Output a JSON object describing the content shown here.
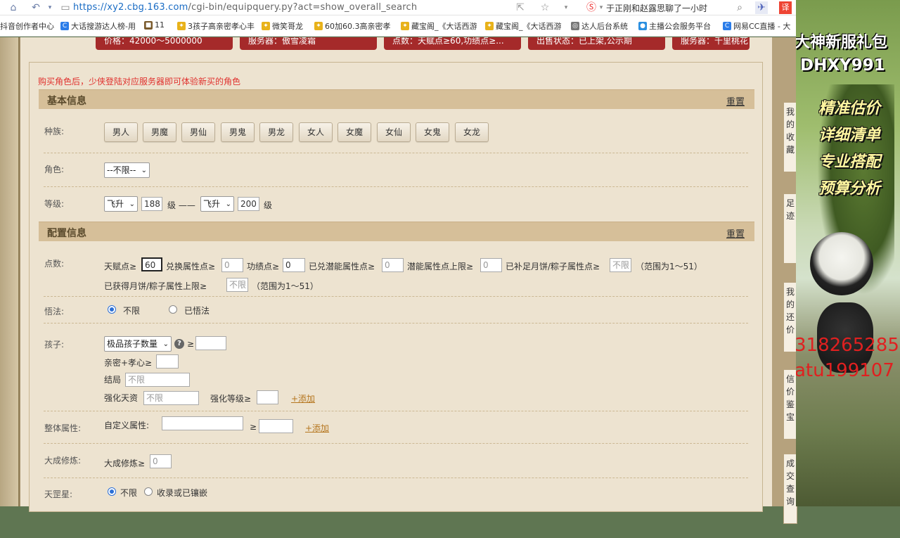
{
  "browser": {
    "url_host": "https://xy2.cbg.163.com",
    "url_path": "/cgi-bin/equipquery.py?act=show_overall_search",
    "tab_title": "于正刚和赵露思聊了一小时",
    "bookmarks": [
      "抖音创作者中心",
      "大话搜游达人榜-用",
      "11",
      "3孩子高亲密孝心丰",
      "微笑哥龙",
      "60加60.3高亲密孝",
      "藏宝阁_《大话西游",
      "藏宝阁_《大话西游",
      "达人后台系统",
      "主播公会服务平台",
      "网易CC直播 - 大"
    ]
  },
  "chips": [
    "价格：42000～5000000",
    "服务器：傲雪凌霜",
    "点数：天赋点≥60,功绩点≥...",
    "出售状态：已上架,公示期",
    "服务器：千里桃花"
  ],
  "notice": "购买角色后，少侠登陆对应服务器即可体验新买的角色",
  "basic": {
    "title": "基本信息",
    "reset": "重置",
    "race_label": "种族:",
    "races": [
      "男人",
      "男魔",
      "男仙",
      "男鬼",
      "男龙",
      "女人",
      "女魔",
      "女仙",
      "女鬼",
      "女龙"
    ],
    "role_label": "角色:",
    "role_value": "--不限--",
    "level_label": "等级:",
    "level_from_type": "飞升",
    "level_from": "188",
    "level_mid": "级 ——",
    "level_to_type": "飞升",
    "level_to": "200",
    "level_end": "级"
  },
  "config": {
    "title": "配置信息",
    "reset": "重置",
    "points_label": "点数:",
    "talent_label": "天赋点≥",
    "talent_value": "60",
    "exchange_label": "兑换属性点≥",
    "exchange_value": "0",
    "merit_label": "功绩点≥",
    "merit_value": "0",
    "potential_label": "已兑潜能属性点≥",
    "potential_value": "0",
    "potential_cap_label": "潜能属性点上限≥",
    "potential_cap_value": "0",
    "mooncake_label": "已补足月饼/粽子属性点≥",
    "mooncake_value": "不限",
    "range_note": "（范围为1～51）",
    "mooncake_cap_label": "已获得月饼/粽子属性上限≥",
    "mooncake_cap_value": "不限",
    "wu_label": "悟法:",
    "wu_opt1": "不限",
    "wu_opt2": "已悟法",
    "child_label": "孩子:",
    "child_select": "极品孩子数量",
    "ge": "≥",
    "intimacy_label": "亲密+孝心≥",
    "ending_label": "结局",
    "ending_placeholder": "不限",
    "enhance_label": "强化天资",
    "enhance_placeholder": "不限",
    "enhance_level_label": "强化等级≥",
    "add_link": "+添加",
    "attr_label": "整体属性:",
    "custom_attr_label": "自定义属性:",
    "cultivate_label": "大成修炼:",
    "cultivate_field_label": "大成修炼≥",
    "cultivate_value": "0",
    "star_label": "天罡星:",
    "star_opt1": "不限",
    "star_opt2": "收录或已镶嵌"
  },
  "side_strip": [
    "我的收藏",
    "足迹",
    "我的还价",
    "信价鉴宝",
    "成交查询"
  ],
  "ad": {
    "line1": "大神新服礼包",
    "line2": "DHXY991",
    "line3": "精准估价",
    "line4": "详细清单",
    "line5": "专业搭配",
    "line6": "预算分析",
    "line7": "318265285",
    "line8": "atu199107"
  },
  "colors": {
    "accent_red": "#a52a2a",
    "link_orange": "#b5761e",
    "notice_red": "#e0322f",
    "section_bar": "#d6bf99"
  }
}
